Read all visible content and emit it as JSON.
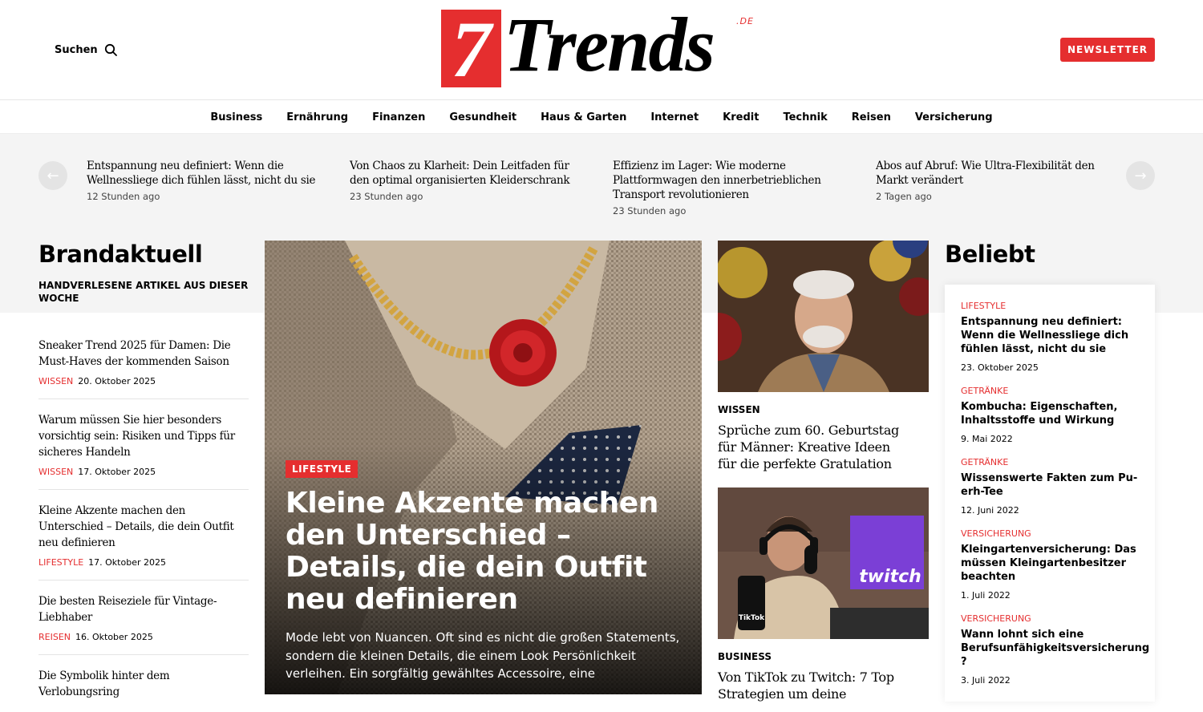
{
  "header": {
    "search_label": "Suchen",
    "logo": {
      "seven": "7",
      "word": "Trends",
      "tld": ".DE"
    },
    "newsletter_label": "NEWSLETTER"
  },
  "nav": {
    "items": [
      "Business",
      "Ernährung",
      "Finanzen",
      "Gesundheit",
      "Haus & Garten",
      "Internet",
      "Kredit",
      "Technik",
      "Reisen",
      "Versicherung"
    ]
  },
  "ticker": {
    "items": [
      {
        "title": "Entspannung neu definiert: Wenn die Wellnessliege dich fühlen lässt, nicht du sie",
        "date": "12 Stunden ago"
      },
      {
        "title": "Von Chaos zu Klarheit: Dein Leitfaden für den optimal organisierten Kleiderschrank",
        "date": "23 Stunden ago"
      },
      {
        "title": "Effizienz im Lager: Wie moderne Plattformwagen den innerbetrieblichen Transport revolutionieren",
        "date": "23 Stunden ago"
      },
      {
        "title": "Abos auf Abruf: Wie Ultra-Flexibilität den Markt verändert",
        "date": "2 Tagen ago"
      }
    ]
  },
  "brandaktuell": {
    "title": "Brandaktuell",
    "subtitle": "HANDVERLESENE ARTIKEL AUS DIESER WOCHE",
    "articles": [
      {
        "title": "Sneaker Trend 2025 für Damen: Die Must-Haves der kommenden Saison",
        "category": "WISSEN",
        "date": "20. Oktober 2025"
      },
      {
        "title": "Warum müssen Sie hier besonders vorsichtig sein: Risiken und Tipps für sicheres Handeln",
        "category": "WISSEN",
        "date": "17. Oktober 2025"
      },
      {
        "title": "Kleine Akzente machen den Unterschied – Details, die dein Outfit neu definieren",
        "category": "LIFESTYLE",
        "date": "17. Oktober 2025"
      },
      {
        "title": "Die besten Reiseziele für Vintage-Liebhaber",
        "category": "REISEN",
        "date": "16. Oktober 2025"
      },
      {
        "title": "Die Symbolik hinter dem Verlobungsring",
        "category": "",
        "date": ""
      }
    ]
  },
  "hero": {
    "category": "LIFESTYLE",
    "title": "Kleine Akzente machen den Unterschied – Details, die dein Outfit neu definieren",
    "excerpt": "Mode lebt von Nuancen. Oft sind es nicht die großen Statements, sondern die kleinen Details, die einem Look Persönlichkeit verleihen. Ein sorgfältig gewähltes Accessoire, eine"
  },
  "cards": [
    {
      "category": "WISSEN",
      "title": "Sprüche zum 60. Geburtstag für Männer: Kreative Ideen für die perfekte Gratulation"
    },
    {
      "category": "BUSINESS",
      "title": "Von TikTok zu Twitch: 7 Top Strategien um deine"
    }
  ],
  "beliebt": {
    "title": "Beliebt",
    "items": [
      {
        "category": "LIFESTYLE",
        "title": "Entspannung neu definiert: Wenn die Wellnessliege dich fühlen lässt, nicht du sie",
        "date": "23. Oktober 2025"
      },
      {
        "category": "GETRÄNKE",
        "title": "Kombucha: Eigenschaften, Inhaltsstoffe und Wirkung",
        "date": "9. Mai 2022"
      },
      {
        "category": "GETRÄNKE",
        "title": "Wissenswerte Fakten zum Pu-erh-Tee",
        "date": "12. Juni 2022"
      },
      {
        "category": "VERSICHERUNG",
        "title": "Kleingartenversicherung: Das müssen Kleingartenbesitzer beachten",
        "date": "1. Juli 2022"
      },
      {
        "category": "VERSICHERUNG",
        "title": "Wann lohnt sich eine Berufsunfähigkeitsversicherung ?",
        "date": "3. Juli 2022"
      }
    ]
  },
  "image_labels": {
    "tiktok": "TikTok",
    "twitch": "twitch"
  },
  "colors": {
    "accent": "#e52e2f"
  }
}
